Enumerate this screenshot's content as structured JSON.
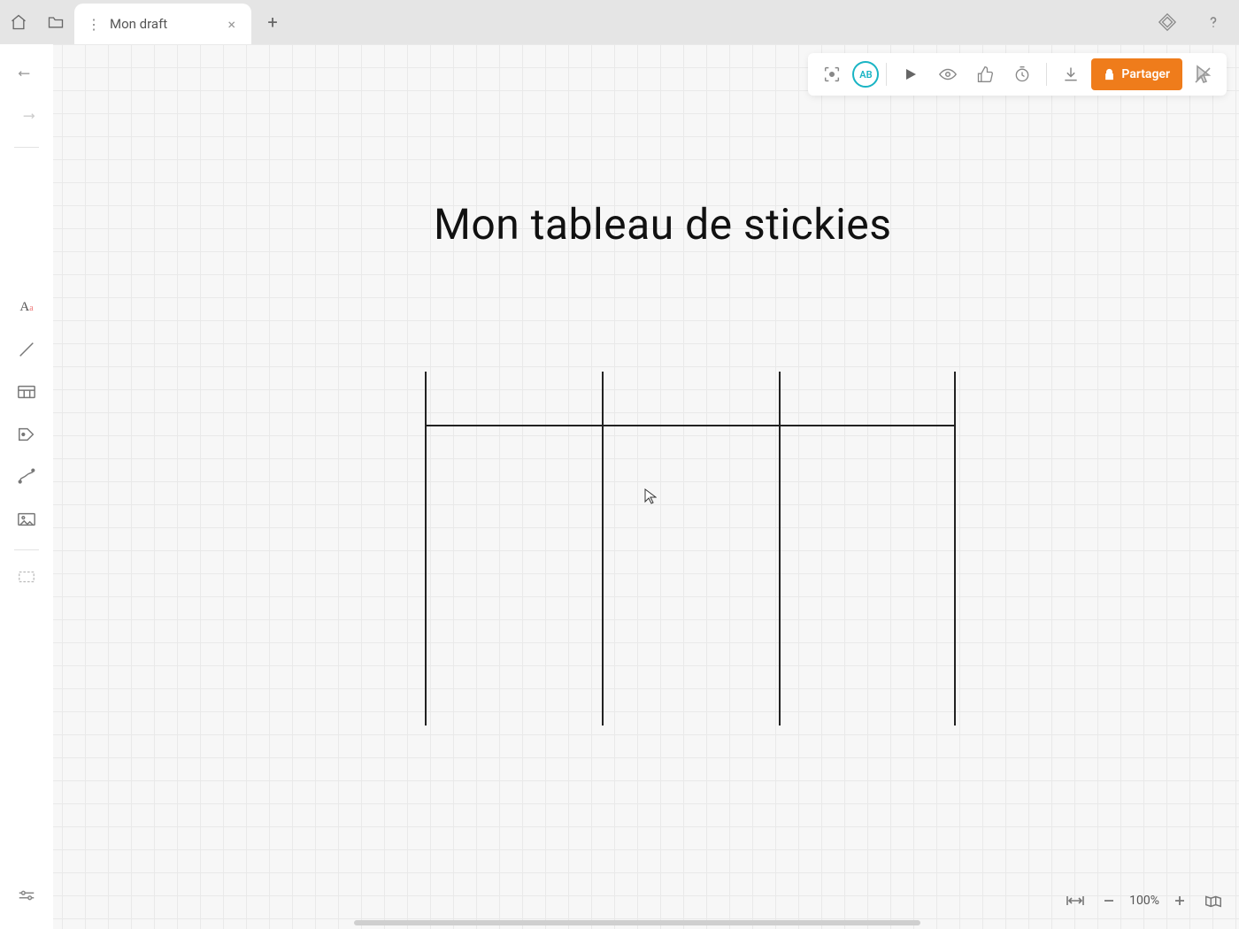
{
  "tabs": {
    "active": {
      "title": "Mon draft"
    }
  },
  "avatar": {
    "initials": "AB"
  },
  "share": {
    "label": "Partager"
  },
  "canvas": {
    "title": "Mon tableau de stickies"
  },
  "zoom": {
    "level": "100%"
  },
  "colors": {
    "accent": "#ef7c1b",
    "avatar": "#19b4c4"
  }
}
